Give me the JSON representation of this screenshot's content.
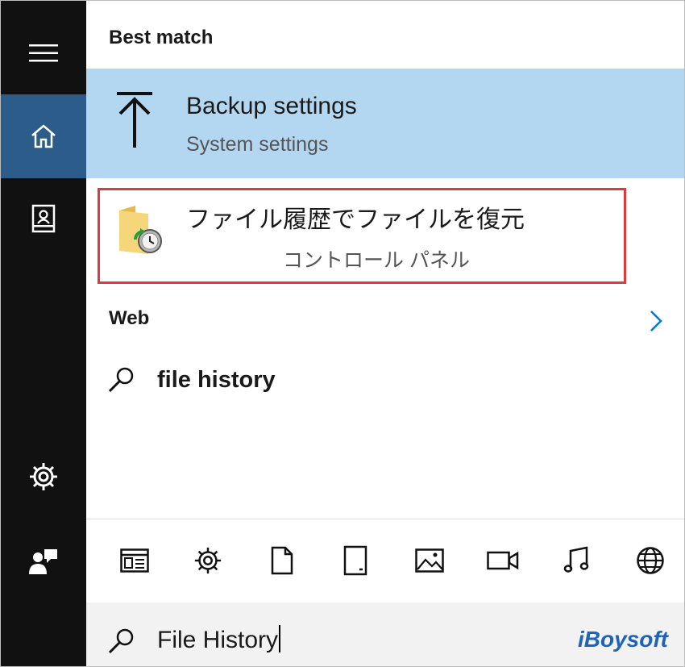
{
  "sidebar": {
    "items": [
      {
        "icon": "hamburger-menu-icon"
      },
      {
        "icon": "home-icon",
        "selected": true
      },
      {
        "icon": "notebook-icon"
      },
      {
        "icon": "gear-icon"
      },
      {
        "icon": "feedback-user-icon"
      }
    ]
  },
  "best_match": {
    "label": "Best match",
    "item": {
      "icon": "upload-arrow-icon",
      "title": "Backup settings",
      "subtitle": "System settings"
    }
  },
  "results": [
    {
      "icon": "folder-clock-icon",
      "title": "ファイル履歴でファイルを復元",
      "subtitle": "コントロール パネル",
      "highlighted": true
    }
  ],
  "web": {
    "label": "Web",
    "query": "file history"
  },
  "filters": [
    {
      "icon": "apps-icon"
    },
    {
      "icon": "settings-icon"
    },
    {
      "icon": "documents-icon"
    },
    {
      "icon": "tablet-icon"
    },
    {
      "icon": "photos-icon"
    },
    {
      "icon": "videos-icon"
    },
    {
      "icon": "music-icon"
    },
    {
      "icon": "web-globe-icon"
    }
  ],
  "search": {
    "value": "File History"
  },
  "watermark": "iBoysoft",
  "colors": {
    "sidebar": "#111111",
    "selected": "#2c5c8a",
    "best_match_bg": "#b4d7f1",
    "highlight_border": "#e0393e",
    "accent": "#0078d7"
  }
}
